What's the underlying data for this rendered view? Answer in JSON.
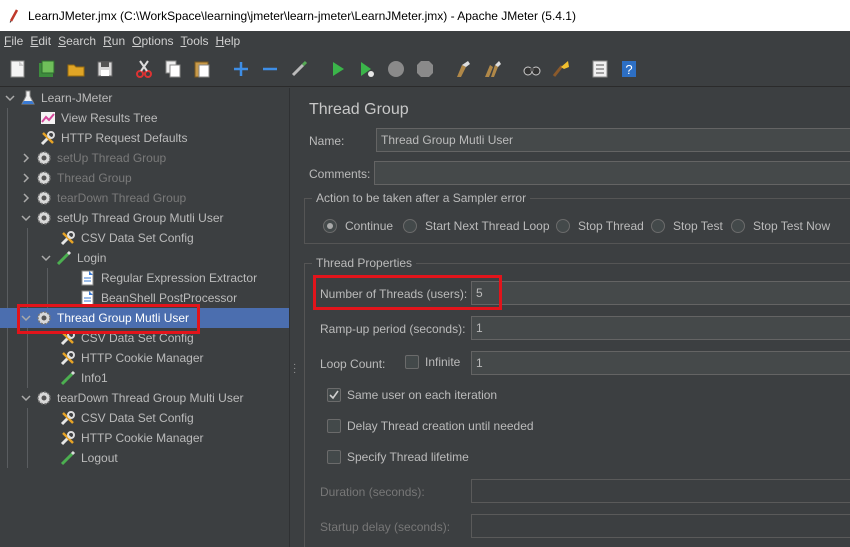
{
  "window": {
    "title": "LearnJMeter.jmx (C:\\WorkSpace\\learning\\jmeter\\learn-jmeter\\LearnJMeter.jmx) - Apache JMeter (5.4.1)"
  },
  "menu": {
    "file": "File",
    "file_u": "F",
    "file_rest": "ile",
    "edit": "Edit",
    "edit_u": "E",
    "edit_rest": "dit",
    "search": "Search",
    "search_u": "S",
    "search_rest": "earch",
    "run": "Run",
    "run_u": "R",
    "run_rest": "un",
    "options": "Options",
    "options_u": "O",
    "options_rest": "ptions",
    "tools": "Tools",
    "tools_u": "T",
    "tools_rest": "ools",
    "help": "Help",
    "help_u": "H",
    "help_rest": "elp"
  },
  "toolbar_icons": [
    "new-icon",
    "templates-icon",
    "open-icon",
    "save-icon",
    "cut-icon",
    "copy-icon",
    "paste-icon",
    "expand-icon",
    "collapse-icon",
    "toggle-icon",
    "start-icon",
    "start-no-pauses-icon",
    "stop-icon",
    "shutdown-icon",
    "clear-icon",
    "clear-all-icon",
    "search-icon",
    "reset-search-icon",
    "function-helper-icon",
    "help-icon"
  ],
  "tree": {
    "items": [
      {
        "label": "Learn-JMeter",
        "icon": "flask-icon",
        "disabled": false
      },
      {
        "label": "View Results Tree",
        "icon": "chart-icon",
        "disabled": false
      },
      {
        "label": "HTTP Request Defaults",
        "icon": "wrench-icon",
        "disabled": false
      },
      {
        "label": "setUp Thread Group",
        "icon": "gear-icon",
        "disabled": true
      },
      {
        "label": "Thread Group",
        "icon": "gear-icon",
        "disabled": true
      },
      {
        "label": "tearDown Thread Group",
        "icon": "gear-icon",
        "disabled": true
      },
      {
        "label": "setUp Thread Group Mutli User",
        "icon": "gear-icon",
        "disabled": false
      },
      {
        "label": "CSV Data Set Config",
        "icon": "wrench-icon",
        "disabled": false
      },
      {
        "label": "Login",
        "icon": "pen-icon",
        "disabled": false
      },
      {
        "label": "Regular Expression Extractor",
        "icon": "doc-icon",
        "disabled": false
      },
      {
        "label": "BeanShell PostProcessor",
        "icon": "doc-icon",
        "disabled": false
      },
      {
        "label": "Thread Group Mutli User",
        "icon": "gear-icon",
        "disabled": false
      },
      {
        "label": "CSV Data Set Config",
        "icon": "wrench-icon",
        "disabled": false
      },
      {
        "label": "HTTP Cookie Manager",
        "icon": "wrench-icon",
        "disabled": false
      },
      {
        "label": "Info1",
        "icon": "pen-icon",
        "disabled": false
      },
      {
        "label": "tearDown Thread Group Multi User",
        "icon": "gear-icon",
        "disabled": false
      },
      {
        "label": "CSV Data Set Config",
        "icon": "wrench-icon",
        "disabled": false
      },
      {
        "label": "HTTP Cookie Manager",
        "icon": "wrench-icon",
        "disabled": false
      },
      {
        "label": "Logout",
        "icon": "pen-icon",
        "disabled": false
      }
    ]
  },
  "panel": {
    "title": "Thread Group",
    "name_label": "Name:",
    "name_value": "Thread Group Mutli User",
    "comments_label": "Comments:",
    "comments_value": "",
    "sampler_error": {
      "title": "Action to be taken after a Sampler error",
      "options": [
        "Continue",
        "Start Next Thread Loop",
        "Stop Thread",
        "Stop Test",
        "Stop Test Now"
      ],
      "selected": "Continue"
    },
    "thread_props": {
      "title": "Thread Properties",
      "num_threads_label": "Number of Threads (users):",
      "num_threads_value": "5",
      "rampup_label": "Ramp-up period (seconds):",
      "rampup_value": "1",
      "loop_label": "Loop Count:",
      "infinite_label": "Infinite",
      "loop_value": "1",
      "same_user_label": "Same user on each iteration",
      "same_user_checked": true,
      "delay_label": "Delay Thread creation until needed",
      "delay_checked": false,
      "lifetime_label": "Specify Thread lifetime",
      "lifetime_checked": false,
      "duration_label": "Duration (seconds):",
      "duration_value": "",
      "startup_label": "Startup delay (seconds):",
      "startup_value": ""
    }
  },
  "colors": {
    "selection": "#4b6eaf",
    "highlight_box": "#e2141b"
  }
}
